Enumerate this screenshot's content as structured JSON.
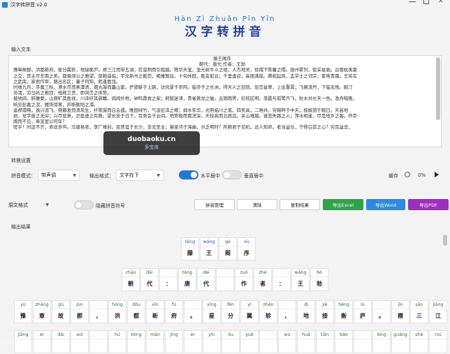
{
  "window": {
    "title": "汉字转拼音",
    "version": "v2.0"
  },
  "banner": {
    "pinyin": "Hàn Zì Zhuǎn Pīn Yīn",
    "hanzi": "汉字转拼音"
  },
  "input_section": {
    "label": "输入文本",
    "lines": [
      "滕王阁序",
      "朝代：唐代 作者：王勃",
      "豫章故郡，洪都新府。星分翼轸，地接衡庐。襟三江而带五湖，控蛮荆而引瓯越。物华天宝，龙光射牛斗之墟；人杰地灵，徐孺下陈蕃之榻。雄州雾列，俊采星驰。台隍枕夷夏",
      "之交，宾主尽东南之美。都督阎公之雅望，棨戟遥临；宇文新州之懿范，襜帷暂驻。十旬休假，胜友如云；千里逢迎，高朋满座。腾蛟起凤，孟学士之词宗；紫电青霜，王将军",
      "之武库。家君作宰，路出名区；童子何知，躬逢胜饯。",
      "时维九月，序属三秋。潦水尽而寒潭清，烟光凝而暮山紫。俨骖騑于上路，访风景于崇阿。临帝子之长洲，得天人之旧馆。层峦耸翠，上出重霄；飞阁流丹，下临无地。鹤汀",
      "凫渚，穷岛屿之萦回；桂殿兰宫，即冈峦之体势。",
      "披绣闼，俯雕甍，山原旷其盈视，川泽纡其骇瞩。闾阎扑地，钟鸣鼎食之家；舸舰迷津，青雀黄龙之舳。云销雨霁，彩彻区明。落霞与孤鹜齐飞，秋水共长天一色。渔舟唱晚，",
      "响穷彭蠡之滨，雁阵惊寒，声断衡阳之浦。",
      "遥襟甫畅，逸兴遄飞。爽籁发而清风生，纤歌凝而白云遏。睢园绿竹，气凌彭泽之樽；邺水朱华，光照临川之笔。四美具，二难并。穷睇眄于中天，极娱游于暇日。天高地",
      "迥，觉宇宙之无穷；兴尽悲来，识盈虚之有数。望长安于日下，目吴会于云间。地势极而南溟深，天柱高而北辰远。关山难越，谁悲失路之人；萍水相逢，尽是他乡之客。怀帝",
      "阍而不见，奉宣室以何年？",
      "嗟乎！时运不齐，命途多舛。冯唐易老，李广难封。屈贾谊于长沙，非无圣主；窜梁鸿于海曲，岂乏明时？所赖君子见机，达人知命。老当益壮，宁移白首之心？穷且益坚，"
    ]
  },
  "settings": {
    "label": "转换设置",
    "mode_label": "拼音模式：",
    "mode_value": "带声调",
    "format_label": "输出格式：",
    "format_value": "文字在下",
    "h_center_label": "水平居中",
    "v_center_label": "垂直居中",
    "cache_label": "缓存",
    "progress_text": "0%",
    "source_format_value": "原文格式",
    "hide_pinyin_label": "隐藏拼音符号"
  },
  "buttons": {
    "pinyin_manage": "拼音管理",
    "clear": "清除",
    "copy_result": "复制结果",
    "export_excel": "导出Excel",
    "export_word": "导出Word",
    "export_pdf": "导出PDF"
  },
  "output_section": {
    "label": "输出结果"
  },
  "output_rows": [
    [
      {
        "py": "téng",
        "hz": "滕"
      },
      {
        "py": "wáng",
        "hz": "王"
      },
      {
        "py": "gé",
        "hz": "阁"
      },
      {
        "py": "xù",
        "hz": "序"
      }
    ],
    [
      {
        "py": "cháo",
        "hz": "朝"
      },
      {
        "py": "dài",
        "hz": "代"
      },
      {
        "py": "",
        "hz": "："
      },
      {
        "py": "táng",
        "hz": "唐"
      },
      {
        "py": "dài",
        "hz": "代"
      },
      {
        "py": "",
        "hz": ""
      },
      {
        "py": "zuò",
        "hz": "作"
      },
      {
        "py": "zhě",
        "hz": "者"
      },
      {
        "py": "",
        "hz": "："
      },
      {
        "py": "wáng",
        "hz": "王"
      },
      {
        "py": "bó",
        "hz": "勃"
      }
    ],
    [
      {
        "py": "yù",
        "hz": "豫"
      },
      {
        "py": "zhāng",
        "hz": "章"
      },
      {
        "py": "gù",
        "hz": "故"
      },
      {
        "py": "jùn",
        "hz": "郡"
      },
      {
        "py": "",
        "hz": "，"
      },
      {
        "py": "hóng",
        "hz": "洪"
      },
      {
        "py": "dōu",
        "hz": "都"
      },
      {
        "py": "xīn",
        "hz": "新"
      },
      {
        "py": "fǔ",
        "hz": "府"
      },
      {
        "py": "",
        "hz": "。"
      },
      {
        "py": "xīng",
        "hz": "星"
      },
      {
        "py": "fēn",
        "hz": "分"
      },
      {
        "py": "yì",
        "hz": "翼"
      },
      {
        "py": "zhěn",
        "hz": "轸"
      },
      {
        "py": "",
        "hz": "，"
      },
      {
        "py": "dì",
        "hz": "地"
      },
      {
        "py": "jiē",
        "hz": "接"
      },
      {
        "py": "héng",
        "hz": "衡"
      },
      {
        "py": "lú",
        "hz": "庐"
      },
      {
        "py": "",
        "hz": "。"
      },
      {
        "py": "jīn",
        "hz": "襟"
      },
      {
        "py": "sān",
        "hz": "三"
      },
      {
        "py": "jiāng",
        "hz": "江"
      }
    ],
    [
      {
        "py": "jiāng",
        "hz": ""
      },
      {
        "py": "ér",
        "hz": ""
      },
      {
        "py": "dài",
        "hz": ""
      },
      {
        "py": "wǔ",
        "hz": ""
      },
      {
        "py": "",
        "hz": ""
      },
      {
        "py": "hú",
        "hz": ""
      },
      {
        "py": "kòng",
        "hz": ""
      },
      {
        "py": "mán",
        "hz": ""
      },
      {
        "py": "jīng",
        "hz": ""
      },
      {
        "py": "ér",
        "hz": ""
      },
      {
        "py": "yǐn",
        "hz": ""
      },
      {
        "py": "ōu",
        "hz": ""
      },
      {
        "py": "yuè",
        "hz": ""
      },
      {
        "py": "",
        "hz": ""
      },
      {
        "py": "wù",
        "hz": ""
      },
      {
        "py": "huá",
        "hz": ""
      },
      {
        "py": "tiān",
        "hz": ""
      },
      {
        "py": "bǎo",
        "hz": ""
      },
      {
        "py": "",
        "hz": ""
      },
      {
        "py": "lóng",
        "hz": ""
      },
      {
        "py": "guāng",
        "hz": ""
      },
      {
        "py": "shè",
        "hz": ""
      },
      {
        "py": "niú",
        "hz": ""
      }
    ]
  ],
  "watermark": {
    "line1": "duobaoku.cn",
    "line2": "多宝库"
  }
}
